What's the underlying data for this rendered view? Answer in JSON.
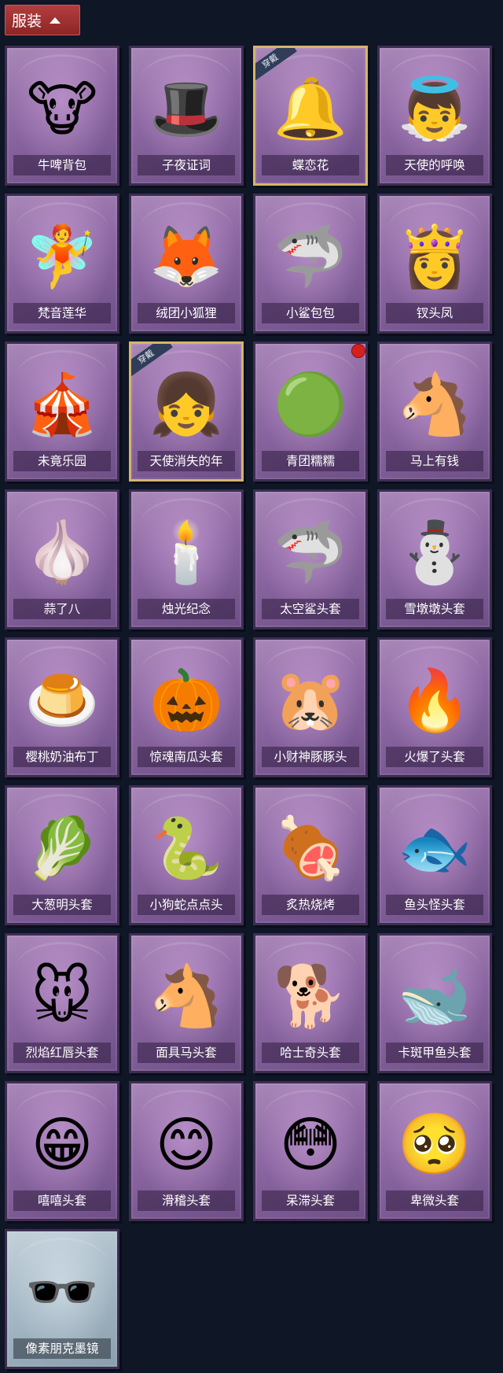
{
  "header": {
    "tab_label": "服装"
  },
  "wearing_label": "穿戴",
  "items": [
    {
      "name": "牛啤背包",
      "icon": "cow-beer-barrel-icon",
      "emoji": "🐮",
      "wearing": false
    },
    {
      "name": "子夜证词",
      "icon": "plague-doctor-icon",
      "emoji": "🎩",
      "wearing": false
    },
    {
      "name": "蝶恋花",
      "icon": "bell-wreath-icon",
      "emoji": "🔔",
      "wearing": true
    },
    {
      "name": "天使的呼唤",
      "icon": "angel-figure-icon",
      "emoji": "👼",
      "wearing": false
    },
    {
      "name": "梵音莲华",
      "icon": "pink-hair-figure-icon",
      "emoji": "🧚",
      "wearing": false
    },
    {
      "name": "绒团小狐狸",
      "icon": "white-fox-icon",
      "emoji": "🦊",
      "wearing": false
    },
    {
      "name": "小鲨包包",
      "icon": "shark-bag-icon",
      "emoji": "🦈",
      "wearing": false
    },
    {
      "name": "钗头凤",
      "icon": "crowned-figure-icon",
      "emoji": "👸",
      "wearing": false
    },
    {
      "name": "未竟乐园",
      "icon": "clown-girl-icon",
      "emoji": "🎪",
      "wearing": false
    },
    {
      "name": "天使消失的年",
      "icon": "angel-girl-icon",
      "emoji": "👧",
      "wearing": true
    },
    {
      "name": "青团糯糯",
      "icon": "green-dumpling-icon",
      "emoji": "🟢",
      "wearing": false,
      "new": true
    },
    {
      "name": "马上有钱",
      "icon": "red-horse-icon",
      "emoji": "🐴",
      "wearing": false
    },
    {
      "name": "蒜了八",
      "icon": "garlic-icon",
      "emoji": "🧄",
      "wearing": false
    },
    {
      "name": "烛光纪念",
      "icon": "candle-icon",
      "emoji": "🕯️",
      "wearing": false
    },
    {
      "name": "太空鲨头套",
      "icon": "space-shark-head-icon",
      "emoji": "🦈",
      "wearing": false
    },
    {
      "name": "雪墩墩头套",
      "icon": "snowman-head-icon",
      "emoji": "⛄",
      "wearing": false
    },
    {
      "name": "樱桃奶油布丁",
      "icon": "pudding-icon",
      "emoji": "🍮",
      "wearing": false
    },
    {
      "name": "惊魂南瓜头套",
      "icon": "pumpkin-head-icon",
      "emoji": "🎃",
      "wearing": false
    },
    {
      "name": "小财神豚豚头",
      "icon": "capybara-head-icon",
      "emoji": "🐹",
      "wearing": false
    },
    {
      "name": "火爆了头套",
      "icon": "fire-head-icon",
      "emoji": "🔥",
      "wearing": false
    },
    {
      "name": "大葱明头套",
      "icon": "green-onion-head-icon",
      "emoji": "🥬",
      "wearing": false
    },
    {
      "name": "小狗蛇点点头",
      "icon": "snake-dog-head-icon",
      "emoji": "🐍",
      "wearing": false
    },
    {
      "name": "炙热烧烤",
      "icon": "meat-bone-head-icon",
      "emoji": "🍖",
      "wearing": false
    },
    {
      "name": "鱼头怪头套",
      "icon": "fish-head-icon",
      "emoji": "🐟",
      "wearing": false
    },
    {
      "name": "烈焰红唇头套",
      "icon": "yellow-mouse-head-icon",
      "emoji": "🐭",
      "wearing": false
    },
    {
      "name": "面具马头套",
      "icon": "horse-mask-icon",
      "emoji": "🐴",
      "wearing": false
    },
    {
      "name": "哈士奇头套",
      "icon": "husky-head-icon",
      "emoji": "🐕",
      "wearing": false
    },
    {
      "name": "卡斑甲鱼头套",
      "icon": "whale-head-icon",
      "emoji": "🐋",
      "wearing": false
    },
    {
      "name": "嘻嘻头套",
      "icon": "grin-emoji-head-icon",
      "emoji": "😁",
      "wearing": false
    },
    {
      "name": "滑稽头套",
      "icon": "funny-emoji-head-icon",
      "emoji": "😊",
      "wearing": false
    },
    {
      "name": "呆滞头套",
      "icon": "stunned-emoji-head-icon",
      "emoji": "😳",
      "wearing": false
    },
    {
      "name": "卑微头套",
      "icon": "timid-emoji-head-icon",
      "emoji": "🥺",
      "wearing": false
    },
    {
      "name": "像素朋克墨镜",
      "icon": "pixel-sunglasses-icon",
      "emoji": "🕶️",
      "wearing": false,
      "grey": true
    }
  ]
}
